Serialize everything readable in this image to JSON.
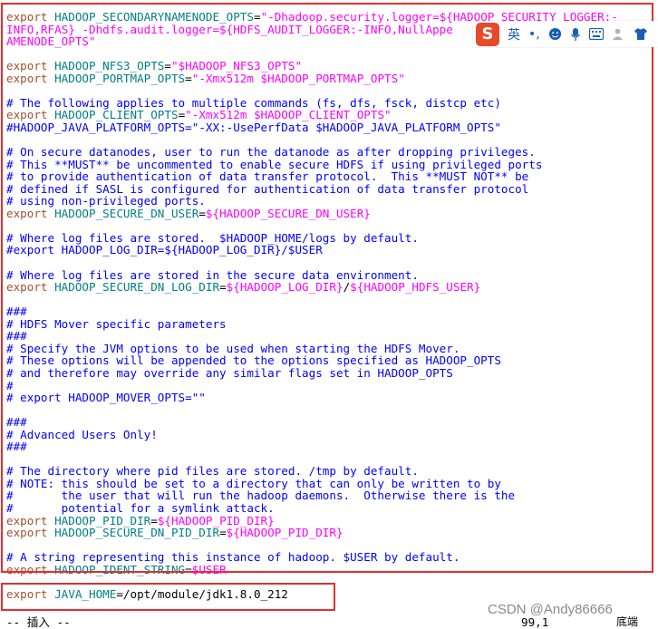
{
  "editor": {
    "lines": [
      {
        "segments": [
          {
            "c": "t-export",
            "t": "export "
          },
          {
            "c": "t-var",
            "t": "HADOOP_SECONDARYNAMENODE_OPTS"
          },
          {
            "c": "t-op",
            "t": "="
          },
          {
            "c": "t-str",
            "t": "\"-Dhadoop.security.logger=${HADOOP_SECURITY_LOGGER:-"
          }
        ]
      },
      {
        "segments": [
          {
            "c": "t-str",
            "t": "INFO,RFAS} -Dhdfs.audit.logger=${HDFS_AUDIT_LOGGER:-INFO,NullAppe"
          }
        ]
      },
      {
        "segments": [
          {
            "c": "t-str",
            "t": "AMENODE_OPTS\""
          }
        ]
      },
      {
        "segments": []
      },
      {
        "segments": [
          {
            "c": "t-export",
            "t": "export "
          },
          {
            "c": "t-var",
            "t": "HADOOP_NFS3_OPTS"
          },
          {
            "c": "t-op",
            "t": "="
          },
          {
            "c": "t-str",
            "t": "\"$HADOOP_NFS3_OPTS\""
          }
        ]
      },
      {
        "segments": [
          {
            "c": "t-export",
            "t": "export "
          },
          {
            "c": "t-var",
            "t": "HADOOP_PORTMAP_OPTS"
          },
          {
            "c": "t-op",
            "t": "="
          },
          {
            "c": "t-str",
            "t": "\"-Xmx512m $HADOOP_PORTMAP_OPTS\""
          }
        ]
      },
      {
        "segments": []
      },
      {
        "segments": [
          {
            "c": "t-cmt",
            "t": "# The following applies to multiple commands (fs, dfs, fsck, distcp etc)"
          }
        ]
      },
      {
        "segments": [
          {
            "c": "t-export",
            "t": "export "
          },
          {
            "c": "t-var",
            "t": "HADOOP_CLIENT_OPTS"
          },
          {
            "c": "t-op",
            "t": "="
          },
          {
            "c": "t-str",
            "t": "\"-Xmx512m $HADOOP_CLIENT_OPTS\""
          }
        ]
      },
      {
        "segments": [
          {
            "c": "t-cmt",
            "t": "#HADOOP_JAVA_PLATFORM_OPTS=\"-XX:-UsePerfData $HADOOP_JAVA_PLATFORM_OPTS\""
          }
        ]
      },
      {
        "segments": []
      },
      {
        "segments": [
          {
            "c": "t-cmt",
            "t": "# On secure datanodes, user to run the datanode as after dropping privileges."
          }
        ]
      },
      {
        "segments": [
          {
            "c": "t-cmt",
            "t": "# This **MUST** be uncommented to enable secure HDFS if using privileged ports"
          }
        ]
      },
      {
        "segments": [
          {
            "c": "t-cmt",
            "t": "# to provide authentication of data transfer protocol.  This **MUST NOT** be"
          }
        ]
      },
      {
        "segments": [
          {
            "c": "t-cmt",
            "t": "# defined if SASL is configured for authentication of data transfer protocol"
          }
        ]
      },
      {
        "segments": [
          {
            "c": "t-cmt",
            "t": "# using non-privileged ports."
          }
        ]
      },
      {
        "segments": [
          {
            "c": "t-export",
            "t": "export "
          },
          {
            "c": "t-var",
            "t": "HADOOP_SECURE_DN_USER"
          },
          {
            "c": "t-op",
            "t": "="
          },
          {
            "c": "t-dollar",
            "t": "${HADOOP_SECURE_DN_USER}"
          }
        ]
      },
      {
        "segments": []
      },
      {
        "segments": [
          {
            "c": "t-cmt",
            "t": "# Where log files are stored.  $HADOOP_HOME/logs by default."
          }
        ]
      },
      {
        "segments": [
          {
            "c": "t-cmt",
            "t": "#export HADOOP_LOG_DIR=${HADOOP_LOG_DIR}/$USER"
          }
        ]
      },
      {
        "segments": []
      },
      {
        "segments": [
          {
            "c": "t-cmt",
            "t": "# Where log files are stored in the secure data environment."
          }
        ]
      },
      {
        "segments": [
          {
            "c": "t-export",
            "t": "export "
          },
          {
            "c": "t-var",
            "t": "HADOOP_SECURE_DN_LOG_DIR"
          },
          {
            "c": "t-op",
            "t": "="
          },
          {
            "c": "t-dollar",
            "t": "${HADOOP_LOG_DIR}"
          },
          {
            "c": "t-op",
            "t": "/"
          },
          {
            "c": "t-dollar",
            "t": "${HADOOP_HDFS_USER}"
          }
        ]
      },
      {
        "segments": []
      },
      {
        "segments": [
          {
            "c": "t-cmt",
            "t": "###"
          }
        ]
      },
      {
        "segments": [
          {
            "c": "t-cmt",
            "t": "# HDFS Mover specific parameters"
          }
        ]
      },
      {
        "segments": [
          {
            "c": "t-cmt",
            "t": "###"
          }
        ]
      },
      {
        "segments": [
          {
            "c": "t-cmt",
            "t": "# Specify the JVM options to be used when starting the HDFS Mover."
          }
        ]
      },
      {
        "segments": [
          {
            "c": "t-cmt",
            "t": "# These options will be appended to the options specified as HADOOP_OPTS"
          }
        ]
      },
      {
        "segments": [
          {
            "c": "t-cmt",
            "t": "# and therefore may override any similar flags set in HADOOP_OPTS"
          }
        ]
      },
      {
        "segments": [
          {
            "c": "t-cmt",
            "t": "#"
          }
        ]
      },
      {
        "segments": [
          {
            "c": "t-cmt",
            "t": "# export HADOOP_MOVER_OPTS=\"\""
          }
        ]
      },
      {
        "segments": []
      },
      {
        "segments": [
          {
            "c": "t-cmt",
            "t": "###"
          }
        ]
      },
      {
        "segments": [
          {
            "c": "t-cmt",
            "t": "# Advanced Users Only!"
          }
        ]
      },
      {
        "segments": [
          {
            "c": "t-cmt",
            "t": "###"
          }
        ]
      },
      {
        "segments": []
      },
      {
        "segments": [
          {
            "c": "t-cmt",
            "t": "# The directory where pid files are stored. /tmp by default."
          }
        ]
      },
      {
        "segments": [
          {
            "c": "t-cmt",
            "t": "# NOTE: this should be set to a directory that can only be written to by"
          }
        ]
      },
      {
        "segments": [
          {
            "c": "t-cmt",
            "t": "#       the user that will run the hadoop daemons.  Otherwise there is the"
          }
        ]
      },
      {
        "segments": [
          {
            "c": "t-cmt",
            "t": "#       potential for a symlink attack."
          }
        ]
      },
      {
        "segments": [
          {
            "c": "t-export",
            "t": "export "
          },
          {
            "c": "t-var",
            "t": "HADOOP_PID_DIR"
          },
          {
            "c": "t-op",
            "t": "="
          },
          {
            "c": "t-dollar",
            "t": "${HADOOP_PID_DIR}"
          }
        ]
      },
      {
        "segments": [
          {
            "c": "t-export",
            "t": "export "
          },
          {
            "c": "t-var",
            "t": "HADOOP_SECURE_DN_PID_DIR"
          },
          {
            "c": "t-op",
            "t": "="
          },
          {
            "c": "t-dollar",
            "t": "${HADOOP_PID_DIR}"
          }
        ]
      },
      {
        "segments": []
      },
      {
        "segments": [
          {
            "c": "t-cmt",
            "t": "# A string representing this instance of hadoop. $USER by default."
          }
        ]
      },
      {
        "segments": [
          {
            "c": "t-export",
            "t": "export "
          },
          {
            "c": "t-var",
            "t": "HADOOP_IDENT_STRING"
          },
          {
            "c": "t-op",
            "t": "="
          },
          {
            "c": "t-dollar",
            "t": "$USER"
          }
        ]
      },
      {
        "segments": []
      },
      {
        "segments": [
          {
            "c": "t-export",
            "t": "export "
          },
          {
            "c": "t-var",
            "t": "JAVA_HOME"
          },
          {
            "c": "t-op",
            "t": "=/opt/module/jdk1.8.0_212"
          }
        ]
      }
    ]
  },
  "statusbar": {
    "mode": "-- 插入 --",
    "cursor_position": "99,1",
    "scroll_position": "底端"
  },
  "watermark": "CSDN @Andy86666",
  "ime_toolbar": {
    "logo_letter": "S",
    "lang_label": "英",
    "punct_label": "•,",
    "icons": [
      "emoji-icon",
      "microphone-icon",
      "keyboard-icon",
      "user-icon",
      "skin-icon"
    ]
  },
  "colors": {
    "keyword": "#a0522d",
    "variable": "#008080",
    "string": "#ff00ff",
    "comment": "#0000ff",
    "highlight_box": "#e03030"
  }
}
